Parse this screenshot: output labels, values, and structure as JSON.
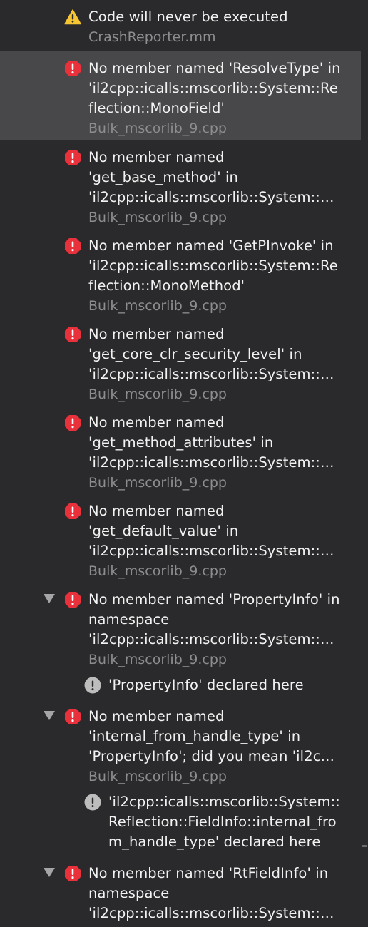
{
  "issues": [
    {
      "type": "warning",
      "lines": [
        "Code will never be executed"
      ],
      "file": "CrashReporter.mm"
    },
    {
      "type": "error",
      "lines": [
        "No member named 'ResolveType' in",
        "'il2cpp::icalls::mscorlib::System::Re",
        "flection::MonoField'"
      ],
      "file": "Bulk_mscorlib_9.cpp"
    },
    {
      "type": "error",
      "lines": [
        "No member named",
        "'get_base_method' in",
        "'il2cpp::icalls::mscorlib::System::…"
      ],
      "file": "Bulk_mscorlib_9.cpp"
    },
    {
      "type": "error",
      "lines": [
        "No member named 'GetPInvoke' in",
        "'il2cpp::icalls::mscorlib::System::Re",
        "flection::MonoMethod'"
      ],
      "file": "Bulk_mscorlib_9.cpp"
    },
    {
      "type": "error",
      "lines": [
        "No member named",
        "'get_core_clr_security_level' in",
        "'il2cpp::icalls::mscorlib::System::…"
      ],
      "file": "Bulk_mscorlib_9.cpp"
    },
    {
      "type": "error",
      "lines": [
        "No member named",
        "'get_method_attributes' in",
        "'il2cpp::icalls::mscorlib::System::…"
      ],
      "file": "Bulk_mscorlib_9.cpp"
    },
    {
      "type": "error",
      "lines": [
        "No member named",
        "'get_default_value' in",
        "'il2cpp::icalls::mscorlib::System::…"
      ],
      "file": "Bulk_mscorlib_9.cpp"
    },
    {
      "type": "error",
      "lines": [
        "No member named 'PropertyInfo' in",
        "namespace",
        "'il2cpp::icalls::mscorlib::System::…"
      ],
      "file": "Bulk_mscorlib_9.cpp"
    },
    {
      "type": "note",
      "lines": [
        "'PropertyInfo' declared here"
      ],
      "file": ""
    },
    {
      "type": "error",
      "lines": [
        "No member named",
        "'internal_from_handle_type' in",
        "'PropertyInfo'; did you mean 'il2c…"
      ],
      "file": "Bulk_mscorlib_9.cpp"
    },
    {
      "type": "note",
      "lines": [
        "'il2cpp::icalls::mscorlib::System::",
        "Reflection::FieldInfo::internal_fro",
        "m_handle_type' declared here"
      ],
      "file": ""
    },
    {
      "type": "error",
      "lines": [
        "No member named 'RtFieldInfo' in",
        "namespace",
        "'il2cpp::icalls::mscorlib::System::…"
      ],
      "file": ""
    }
  ],
  "icons": {
    "warning": "warning-triangle-icon",
    "error": "error-octagon-icon",
    "note": "note-circle-icon",
    "disclosure": "disclosure-triangle-icon"
  },
  "colors": {
    "background": "#2a2a2c",
    "selected_row": "#48484a",
    "error": "#e8313a",
    "warning": "#f7c531",
    "note": "#bdbdbd",
    "text": "#f2f2f2",
    "file_text": "#8d8d90"
  },
  "state": {
    "selected_index": 1,
    "expanded": [
      7,
      9,
      11
    ],
    "children": [
      8,
      10
    ]
  }
}
